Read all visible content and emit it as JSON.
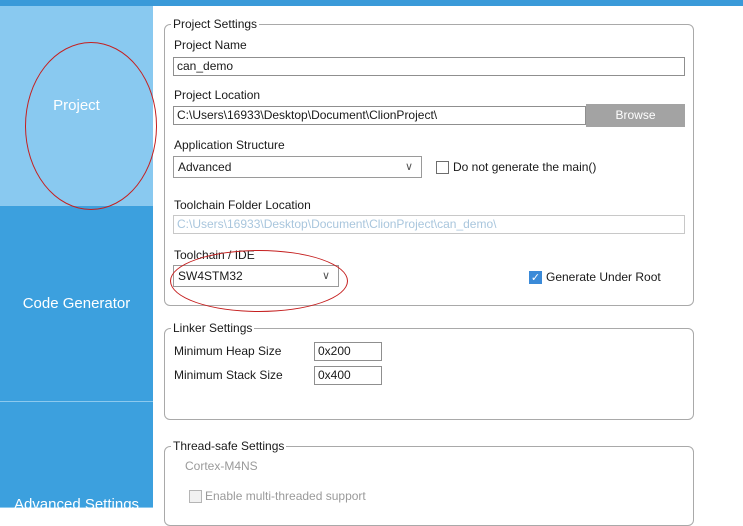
{
  "sidebar": {
    "tabs": [
      {
        "label": "Project",
        "active": true
      },
      {
        "label": "Code Generator",
        "active": false
      },
      {
        "label": "Advanced Settings",
        "active": false
      }
    ]
  },
  "project_settings": {
    "legend": "Project Settings",
    "project_name_label": "Project Name",
    "project_name_value": "can_demo",
    "project_location_label": "Project Location",
    "project_location_value": "C:\\Users\\16933\\Desktop\\Document\\ClionProject\\",
    "browse_label": "Browse",
    "app_structure_label": "Application Structure",
    "app_structure_value": "Advanced",
    "do_not_generate_main_label": "Do not generate the main()",
    "do_not_generate_main_checked": false,
    "toolchain_folder_label": "Toolchain Folder Location",
    "toolchain_folder_value": "C:\\Users\\16933\\Desktop\\Document\\ClionProject\\can_demo\\",
    "toolchain_ide_label": "Toolchain / IDE",
    "toolchain_ide_value": "SW4STM32",
    "generate_under_root_label": "Generate Under Root",
    "generate_under_root_checked": true
  },
  "linker_settings": {
    "legend": "Linker Settings",
    "min_heap_label": "Minimum Heap Size",
    "min_heap_value": "0x200",
    "min_stack_label": "Minimum Stack Size",
    "min_stack_value": "0x400"
  },
  "thread_safe_settings": {
    "legend": "Thread-safe Settings",
    "core_label": "Cortex-M4NS",
    "enable_multithread_label": "Enable multi-threaded support",
    "enable_multithread_checked": false
  },
  "icons": {
    "dropdown": "chevron-down-icon",
    "check": "checkmark-icon"
  },
  "colors": {
    "sidebar_active": "#89c9f0",
    "sidebar_normal": "#3ca0de",
    "browse_button": "#a3a3a3",
    "annotation": "#c51f1f",
    "checkbox_checked": "#3a8ad8"
  }
}
